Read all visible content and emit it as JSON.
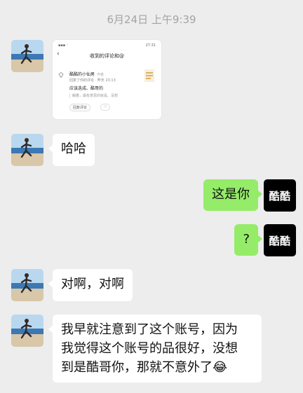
{
  "timestamp": "6月24日 上午9:39",
  "contact": {
    "avatar_icon": "runner-on-beach-photo-icon"
  },
  "self": {
    "avatar_text": "酷酷"
  },
  "shared_image": {
    "status_left": "",
    "status_right": "27:31",
    "header": "收到的评论和@",
    "commenter": "酷酷的小仙男",
    "commenter_tag": "作者",
    "meta": "回复了你的评论 · 昨天 23:13",
    "comment": "应该迭成、酷哥的",
    "original_quote": "躺着，最有意思的就是、没想",
    "reply_label": "回复评论",
    "like_label": "♡"
  },
  "messages": [
    {
      "side": "in",
      "text": "哈哈"
    },
    {
      "side": "out",
      "text": "这是你"
    },
    {
      "side": "out",
      "text": "?"
    },
    {
      "side": "in",
      "text": "对啊，对啊"
    },
    {
      "side": "in",
      "lines": [
        "我早就注意到了这个账号，因为",
        "我觉得这个账号的品很好，没想",
        "到是酷哥你，那就不意外了😂"
      ]
    }
  ]
}
